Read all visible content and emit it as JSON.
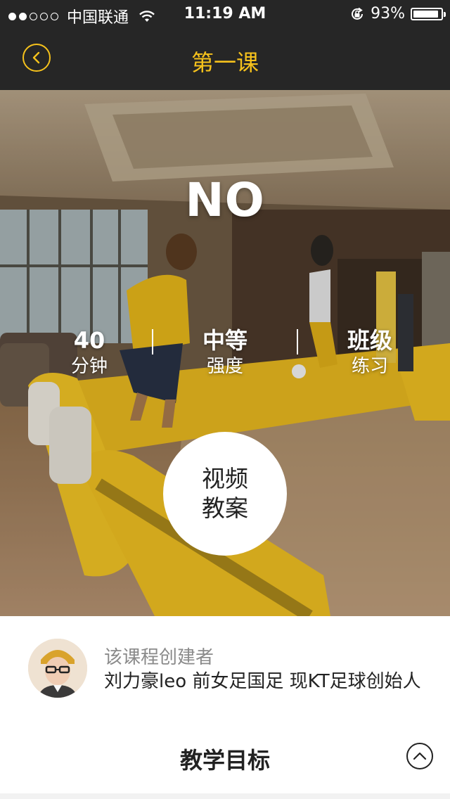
{
  "status_bar": {
    "carrier": "中国联通",
    "time": "11:19 AM",
    "battery_percent": "93%",
    "battery_level": 0.93,
    "signal_bars": 2
  },
  "nav": {
    "title": "第一课"
  },
  "hero": {
    "title": "NO",
    "stats": [
      {
        "value": "40",
        "label": "分钟"
      },
      {
        "value": "中等",
        "label": "强度"
      },
      {
        "value": "班级",
        "label": "练习"
      }
    ],
    "video_button": {
      "line1": "视频",
      "line2": "教案"
    }
  },
  "creator": {
    "label": "该课程创建者",
    "name": "刘力豪leo 前女足国足   现KT足球创始人"
  },
  "goals": {
    "title": "教学目标"
  },
  "colors": {
    "accent": "#f6c21c",
    "topbar": "#262626"
  }
}
